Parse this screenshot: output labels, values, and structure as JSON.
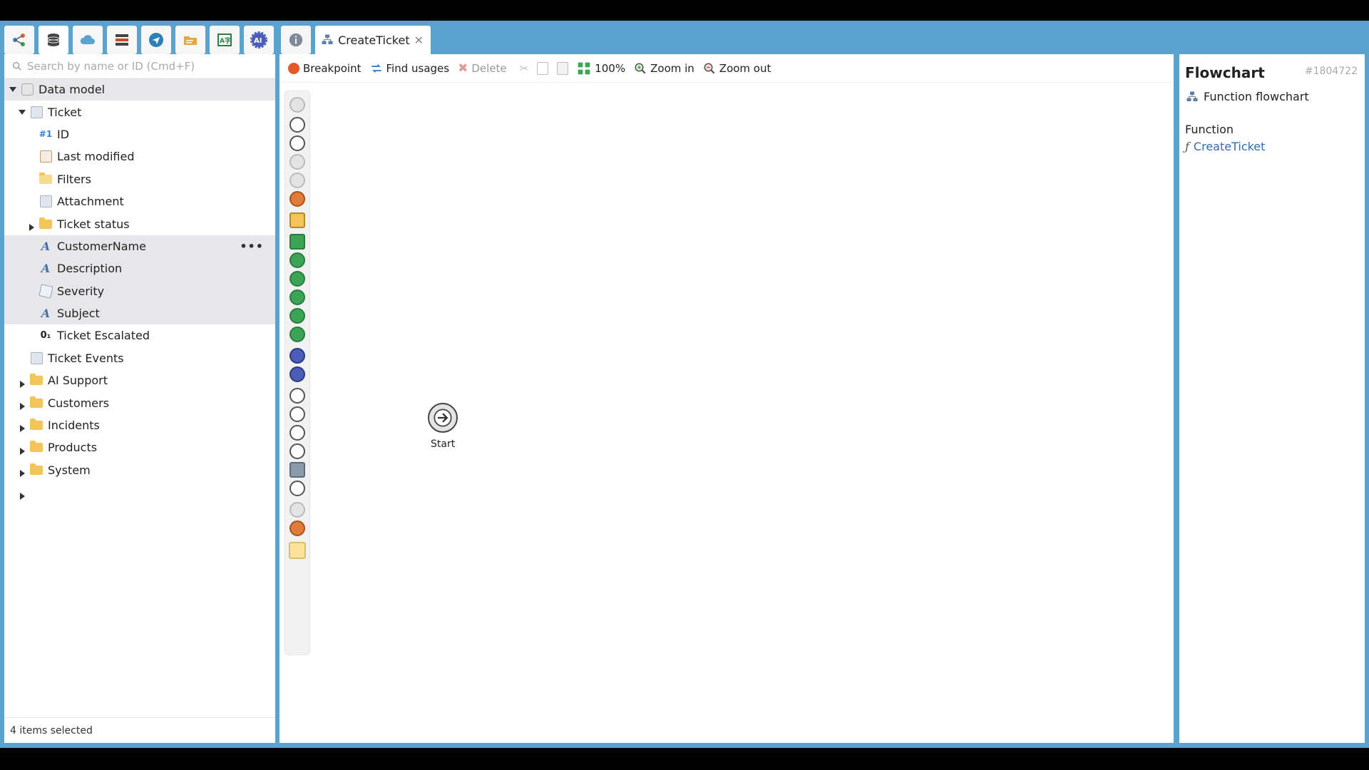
{
  "toolbar": {
    "buttons": [
      {
        "name": "share-icon",
        "color": "#3b82c4"
      },
      {
        "name": "database-icon",
        "color": "#444444"
      },
      {
        "name": "cloud-icon",
        "color": "#5aa3cf"
      },
      {
        "name": "server-icon",
        "color": "#444444"
      },
      {
        "name": "send-icon",
        "color": "#2d7fb8"
      },
      {
        "name": "folder-icon",
        "color": "#e6a83a"
      },
      {
        "name": "translate-icon",
        "color": "#2d7d4a"
      },
      {
        "name": "ai-icon",
        "color": "#4b5db8"
      }
    ],
    "info_icon": "info-icon",
    "tab_label": "CreateTicket",
    "tab_close": "✕"
  },
  "left": {
    "search_placeholder": "Search by name or ID (Cmd+F)",
    "tree": [
      {
        "label": "Data model",
        "level": 0,
        "arrow": "down",
        "icon": "datamodel",
        "selected": true
      },
      {
        "label": "Ticket",
        "level": 1,
        "arrow": "down",
        "icon": "entity",
        "selected": false
      },
      {
        "label": "ID",
        "level": 2,
        "arrow": "",
        "icon": "id",
        "selected": false
      },
      {
        "label": "Last modified",
        "level": 2,
        "arrow": "",
        "icon": "calendar",
        "selected": false
      },
      {
        "label": "Filters",
        "level": 2,
        "arrow": "",
        "icon": "filter",
        "selected": false
      },
      {
        "label": "Attachment",
        "level": 2,
        "arrow": "right",
        "icon": "entity",
        "selected": false
      },
      {
        "label": "Ticket status",
        "level": 2,
        "arrow": "right",
        "icon": "folder",
        "selected": false
      },
      {
        "label": "CustomerName",
        "level": 2,
        "arrow": "",
        "icon": "text",
        "selected": true,
        "more": "•••"
      },
      {
        "label": "Description",
        "level": 2,
        "arrow": "",
        "icon": "text",
        "selected": true
      },
      {
        "label": "Severity",
        "level": 2,
        "arrow": "",
        "icon": "enum",
        "selected": true
      },
      {
        "label": "Subject",
        "level": 2,
        "arrow": "",
        "icon": "text",
        "selected": true
      },
      {
        "label": "Ticket Escalated",
        "level": 2,
        "arrow": "",
        "icon": "bool",
        "selected": false
      },
      {
        "label": "Ticket Events",
        "level": 1,
        "arrow": "right",
        "icon": "entity",
        "selected": false
      },
      {
        "label": "AI Support",
        "level": 1,
        "arrow": "right",
        "icon": "folder",
        "selected": false
      },
      {
        "label": "Customers",
        "level": 1,
        "arrow": "right",
        "icon": "folder",
        "selected": false
      },
      {
        "label": "Incidents",
        "level": 1,
        "arrow": "right",
        "icon": "folder",
        "selected": false
      },
      {
        "label": "Products",
        "level": 1,
        "arrow": "right",
        "icon": "folder",
        "selected": false
      },
      {
        "label": "System",
        "level": 1,
        "arrow": "right",
        "icon": "folder",
        "selected": false
      }
    ],
    "status": "4 items selected"
  },
  "center": {
    "toolbar": {
      "breakpoint": "Breakpoint",
      "find_usages": "Find usages",
      "delete": "Delete",
      "zoom_level": "100%",
      "zoom_in": "Zoom in",
      "zoom_out": "Zoom out"
    },
    "palette": [
      {
        "name": "info-tool-icon",
        "style": "grey"
      },
      {
        "name": "event-tool-icon",
        "style": "plain"
      },
      {
        "name": "branch-tool-icon",
        "style": "plain"
      },
      {
        "name": "back-tool-icon",
        "style": "grey"
      },
      {
        "name": "forward-tool-icon",
        "style": "grey"
      },
      {
        "name": "user-tool-icon",
        "style": "orange"
      },
      {
        "name": "question-tool-icon",
        "style": "folder"
      },
      {
        "name": "create-tool-icon",
        "style": "green-sq"
      },
      {
        "name": "list-tool-icon",
        "style": "green"
      },
      {
        "name": "loop-tool-icon",
        "style": "green"
      },
      {
        "name": "copy-tool-icon",
        "style": "green"
      },
      {
        "name": "save-tool-icon",
        "style": "green"
      },
      {
        "name": "erase-tool-icon",
        "style": "green"
      },
      {
        "name": "ai-tool-icon",
        "style": "blue"
      },
      {
        "name": "agent-tool-icon",
        "style": "blue"
      },
      {
        "name": "input-tool-icon",
        "style": "plain"
      },
      {
        "name": "output-tool-icon",
        "style": "plain"
      },
      {
        "name": "cloud-tool-icon",
        "style": "plain"
      },
      {
        "name": "web-tool-icon",
        "style": "plain"
      },
      {
        "name": "folder-tool-icon",
        "style": "folder-grey"
      },
      {
        "name": "print-tool-icon",
        "style": "plain"
      },
      {
        "name": "help-tool-icon",
        "style": "grey"
      },
      {
        "name": "alert-tool-icon",
        "style": "orange"
      },
      {
        "name": "note-tool-icon",
        "style": "note"
      }
    ],
    "start_label": "Start"
  },
  "right": {
    "title": "Flowchart",
    "id": "#1804722",
    "type_label": "Function flowchart",
    "section_label": "Function",
    "function_link": "CreateTicket"
  }
}
